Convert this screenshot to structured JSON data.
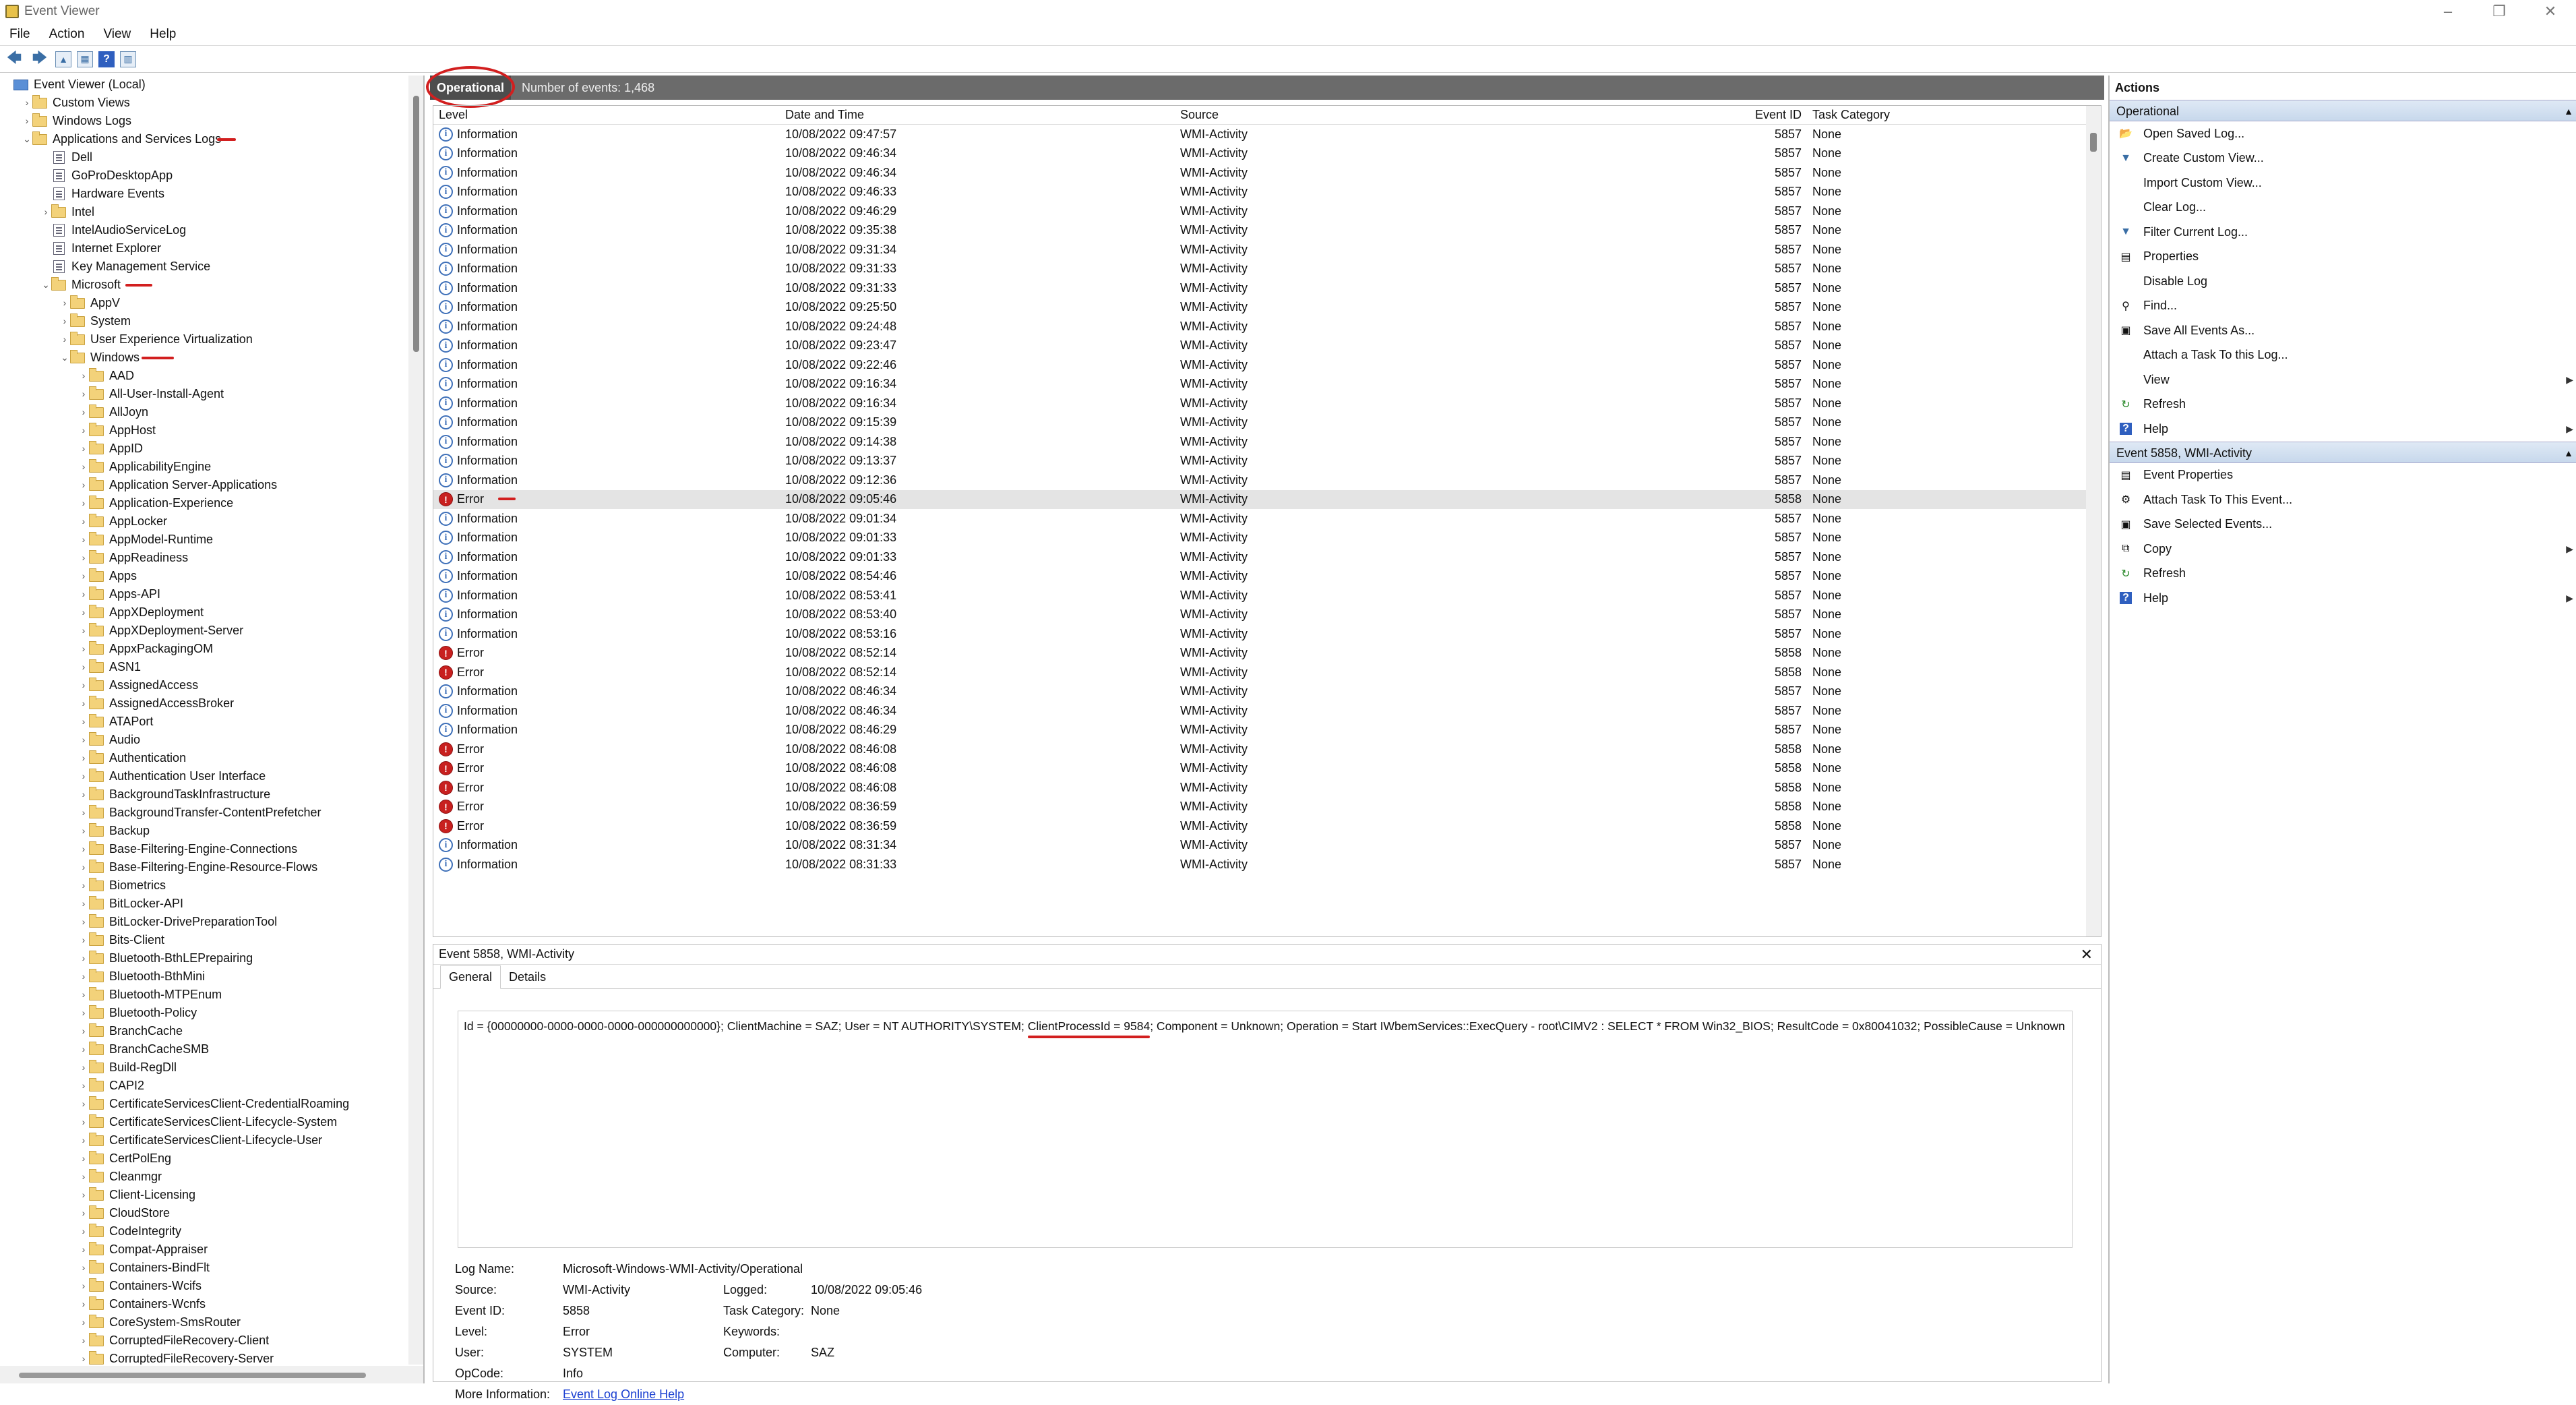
{
  "window": {
    "title": "Event Viewer"
  },
  "menu": [
    "File",
    "Action",
    "View",
    "Help"
  ],
  "tree": [
    {
      "label": "Event Viewer (Local)",
      "indent": 0,
      "arrow": "",
      "icon": "pc"
    },
    {
      "label": "Custom Views",
      "indent": 1,
      "arrow": "›",
      "icon": "folder"
    },
    {
      "label": "Windows Logs",
      "indent": 1,
      "arrow": "›",
      "icon": "folder"
    },
    {
      "label": "Applications and Services Logs",
      "indent": 1,
      "arrow": "⌄",
      "icon": "folder",
      "marked": true
    },
    {
      "label": "Dell",
      "indent": 2,
      "arrow": "",
      "icon": "log"
    },
    {
      "label": "GoProDesktopApp",
      "indent": 2,
      "arrow": "",
      "icon": "log"
    },
    {
      "label": "Hardware Events",
      "indent": 2,
      "arrow": "",
      "icon": "log"
    },
    {
      "label": "Intel",
      "indent": 2,
      "arrow": "›",
      "icon": "folder"
    },
    {
      "label": "IntelAudioServiceLog",
      "indent": 2,
      "arrow": "",
      "icon": "log"
    },
    {
      "label": "Internet Explorer",
      "indent": 2,
      "arrow": "",
      "icon": "log"
    },
    {
      "label": "Key Management Service",
      "indent": 2,
      "arrow": "",
      "icon": "log"
    },
    {
      "label": "Microsoft",
      "indent": 2,
      "arrow": "⌄",
      "icon": "folder",
      "marked": true
    },
    {
      "label": "AppV",
      "indent": 3,
      "arrow": "›",
      "icon": "folder"
    },
    {
      "label": "System",
      "indent": 3,
      "arrow": "›",
      "icon": "folder"
    },
    {
      "label": "User Experience Virtualization",
      "indent": 3,
      "arrow": "›",
      "icon": "folder"
    },
    {
      "label": "Windows",
      "indent": 3,
      "arrow": "⌄",
      "icon": "folder",
      "marked": true
    },
    {
      "label": "AAD",
      "indent": 4,
      "arrow": "›",
      "icon": "folder"
    },
    {
      "label": "All-User-Install-Agent",
      "indent": 4,
      "arrow": "›",
      "icon": "folder"
    },
    {
      "label": "AllJoyn",
      "indent": 4,
      "arrow": "›",
      "icon": "folder"
    },
    {
      "label": "AppHost",
      "indent": 4,
      "arrow": "›",
      "icon": "folder"
    },
    {
      "label": "AppID",
      "indent": 4,
      "arrow": "›",
      "icon": "folder"
    },
    {
      "label": "ApplicabilityEngine",
      "indent": 4,
      "arrow": "›",
      "icon": "folder"
    },
    {
      "label": "Application Server-Applications",
      "indent": 4,
      "arrow": "›",
      "icon": "folder"
    },
    {
      "label": "Application-Experience",
      "indent": 4,
      "arrow": "›",
      "icon": "folder"
    },
    {
      "label": "AppLocker",
      "indent": 4,
      "arrow": "›",
      "icon": "folder"
    },
    {
      "label": "AppModel-Runtime",
      "indent": 4,
      "arrow": "›",
      "icon": "folder"
    },
    {
      "label": "AppReadiness",
      "indent": 4,
      "arrow": "›",
      "icon": "folder"
    },
    {
      "label": "Apps",
      "indent": 4,
      "arrow": "›",
      "icon": "folder"
    },
    {
      "label": "Apps-API",
      "indent": 4,
      "arrow": "›",
      "icon": "folder"
    },
    {
      "label": "AppXDeployment",
      "indent": 4,
      "arrow": "›",
      "icon": "folder"
    },
    {
      "label": "AppXDeployment-Server",
      "indent": 4,
      "arrow": "›",
      "icon": "folder"
    },
    {
      "label": "AppxPackagingOM",
      "indent": 4,
      "arrow": "›",
      "icon": "folder"
    },
    {
      "label": "ASN1",
      "indent": 4,
      "arrow": "›",
      "icon": "folder"
    },
    {
      "label": "AssignedAccess",
      "indent": 4,
      "arrow": "›",
      "icon": "folder"
    },
    {
      "label": "AssignedAccessBroker",
      "indent": 4,
      "arrow": "›",
      "icon": "folder"
    },
    {
      "label": "ATAPort",
      "indent": 4,
      "arrow": "›",
      "icon": "folder"
    },
    {
      "label": "Audio",
      "indent": 4,
      "arrow": "›",
      "icon": "folder"
    },
    {
      "label": "Authentication",
      "indent": 4,
      "arrow": "›",
      "icon": "folder"
    },
    {
      "label": "Authentication User Interface",
      "indent": 4,
      "arrow": "›",
      "icon": "folder"
    },
    {
      "label": "BackgroundTaskInfrastructure",
      "indent": 4,
      "arrow": "›",
      "icon": "folder"
    },
    {
      "label": "BackgroundTransfer-ContentPrefetcher",
      "indent": 4,
      "arrow": "›",
      "icon": "folder"
    },
    {
      "label": "Backup",
      "indent": 4,
      "arrow": "›",
      "icon": "folder"
    },
    {
      "label": "Base-Filtering-Engine-Connections",
      "indent": 4,
      "arrow": "›",
      "icon": "folder"
    },
    {
      "label": "Base-Filtering-Engine-Resource-Flows",
      "indent": 4,
      "arrow": "›",
      "icon": "folder"
    },
    {
      "label": "Biometrics",
      "indent": 4,
      "arrow": "›",
      "icon": "folder"
    },
    {
      "label": "BitLocker-API",
      "indent": 4,
      "arrow": "›",
      "icon": "folder"
    },
    {
      "label": "BitLocker-DrivePreparationTool",
      "indent": 4,
      "arrow": "›",
      "icon": "folder"
    },
    {
      "label": "Bits-Client",
      "indent": 4,
      "arrow": "›",
      "icon": "folder"
    },
    {
      "label": "Bluetooth-BthLEPrepairing",
      "indent": 4,
      "arrow": "›",
      "icon": "folder"
    },
    {
      "label": "Bluetooth-BthMini",
      "indent": 4,
      "arrow": "›",
      "icon": "folder"
    },
    {
      "label": "Bluetooth-MTPEnum",
      "indent": 4,
      "arrow": "›",
      "icon": "folder"
    },
    {
      "label": "Bluetooth-Policy",
      "indent": 4,
      "arrow": "›",
      "icon": "folder"
    },
    {
      "label": "BranchCache",
      "indent": 4,
      "arrow": "›",
      "icon": "folder"
    },
    {
      "label": "BranchCacheSMB",
      "indent": 4,
      "arrow": "›",
      "icon": "folder"
    },
    {
      "label": "Build-RegDll",
      "indent": 4,
      "arrow": "›",
      "icon": "folder"
    },
    {
      "label": "CAPI2",
      "indent": 4,
      "arrow": "›",
      "icon": "folder"
    },
    {
      "label": "CertificateServicesClient-CredentialRoaming",
      "indent": 4,
      "arrow": "›",
      "icon": "folder"
    },
    {
      "label": "CertificateServicesClient-Lifecycle-System",
      "indent": 4,
      "arrow": "›",
      "icon": "folder"
    },
    {
      "label": "CertificateServicesClient-Lifecycle-User",
      "indent": 4,
      "arrow": "›",
      "icon": "folder"
    },
    {
      "label": "CertPolEng",
      "indent": 4,
      "arrow": "›",
      "icon": "folder"
    },
    {
      "label": "Cleanmgr",
      "indent": 4,
      "arrow": "›",
      "icon": "folder"
    },
    {
      "label": "Client-Licensing",
      "indent": 4,
      "arrow": "›",
      "icon": "folder"
    },
    {
      "label": "CloudStore",
      "indent": 4,
      "arrow": "›",
      "icon": "folder"
    },
    {
      "label": "CodeIntegrity",
      "indent": 4,
      "arrow": "›",
      "icon": "folder"
    },
    {
      "label": "Compat-Appraiser",
      "indent": 4,
      "arrow": "›",
      "icon": "folder"
    },
    {
      "label": "Containers-BindFlt",
      "indent": 4,
      "arrow": "›",
      "icon": "folder"
    },
    {
      "label": "Containers-Wcifs",
      "indent": 4,
      "arrow": "›",
      "icon": "folder"
    },
    {
      "label": "Containers-Wcnfs",
      "indent": 4,
      "arrow": "›",
      "icon": "folder"
    },
    {
      "label": "CoreSystem-SmsRouter",
      "indent": 4,
      "arrow": "›",
      "icon": "folder"
    },
    {
      "label": "CorruptedFileRecovery-Client",
      "indent": 4,
      "arrow": "›",
      "icon": "folder"
    },
    {
      "label": "CorruptedFileRecovery-Server",
      "indent": 4,
      "arrow": "›",
      "icon": "folder"
    }
  ],
  "log": {
    "name": "Operational",
    "count": "Number of events: 1,468"
  },
  "columns": [
    "Level",
    "Date and Time",
    "Source",
    "Event ID",
    "Task Category"
  ],
  "events": [
    {
      "level": "Information",
      "date": "10/08/2022 09:47:57",
      "source": "WMI-Activity",
      "id": "5857",
      "task": "None"
    },
    {
      "level": "Information",
      "date": "10/08/2022 09:46:34",
      "source": "WMI-Activity",
      "id": "5857",
      "task": "None"
    },
    {
      "level": "Information",
      "date": "10/08/2022 09:46:34",
      "source": "WMI-Activity",
      "id": "5857",
      "task": "None"
    },
    {
      "level": "Information",
      "date": "10/08/2022 09:46:33",
      "source": "WMI-Activity",
      "id": "5857",
      "task": "None"
    },
    {
      "level": "Information",
      "date": "10/08/2022 09:46:29",
      "source": "WMI-Activity",
      "id": "5857",
      "task": "None"
    },
    {
      "level": "Information",
      "date": "10/08/2022 09:35:38",
      "source": "WMI-Activity",
      "id": "5857",
      "task": "None"
    },
    {
      "level": "Information",
      "date": "10/08/2022 09:31:34",
      "source": "WMI-Activity",
      "id": "5857",
      "task": "None"
    },
    {
      "level": "Information",
      "date": "10/08/2022 09:31:33",
      "source": "WMI-Activity",
      "id": "5857",
      "task": "None"
    },
    {
      "level": "Information",
      "date": "10/08/2022 09:31:33",
      "source": "WMI-Activity",
      "id": "5857",
      "task": "None"
    },
    {
      "level": "Information",
      "date": "10/08/2022 09:25:50",
      "source": "WMI-Activity",
      "id": "5857",
      "task": "None"
    },
    {
      "level": "Information",
      "date": "10/08/2022 09:24:48",
      "source": "WMI-Activity",
      "id": "5857",
      "task": "None"
    },
    {
      "level": "Information",
      "date": "10/08/2022 09:23:47",
      "source": "WMI-Activity",
      "id": "5857",
      "task": "None"
    },
    {
      "level": "Information",
      "date": "10/08/2022 09:22:46",
      "source": "WMI-Activity",
      "id": "5857",
      "task": "None"
    },
    {
      "level": "Information",
      "date": "10/08/2022 09:16:34",
      "source": "WMI-Activity",
      "id": "5857",
      "task": "None"
    },
    {
      "level": "Information",
      "date": "10/08/2022 09:16:34",
      "source": "WMI-Activity",
      "id": "5857",
      "task": "None"
    },
    {
      "level": "Information",
      "date": "10/08/2022 09:15:39",
      "source": "WMI-Activity",
      "id": "5857",
      "task": "None"
    },
    {
      "level": "Information",
      "date": "10/08/2022 09:14:38",
      "source": "WMI-Activity",
      "id": "5857",
      "task": "None"
    },
    {
      "level": "Information",
      "date": "10/08/2022 09:13:37",
      "source": "WMI-Activity",
      "id": "5857",
      "task": "None"
    },
    {
      "level": "Information",
      "date": "10/08/2022 09:12:36",
      "source": "WMI-Activity",
      "id": "5857",
      "task": "None"
    },
    {
      "level": "Error",
      "date": "10/08/2022 09:05:46",
      "source": "WMI-Activity",
      "id": "5858",
      "task": "None",
      "selected": true,
      "marked": true
    },
    {
      "level": "Information",
      "date": "10/08/2022 09:01:34",
      "source": "WMI-Activity",
      "id": "5857",
      "task": "None"
    },
    {
      "level": "Information",
      "date": "10/08/2022 09:01:33",
      "source": "WMI-Activity",
      "id": "5857",
      "task": "None"
    },
    {
      "level": "Information",
      "date": "10/08/2022 09:01:33",
      "source": "WMI-Activity",
      "id": "5857",
      "task": "None"
    },
    {
      "level": "Information",
      "date": "10/08/2022 08:54:46",
      "source": "WMI-Activity",
      "id": "5857",
      "task": "None"
    },
    {
      "level": "Information",
      "date": "10/08/2022 08:53:41",
      "source": "WMI-Activity",
      "id": "5857",
      "task": "None"
    },
    {
      "level": "Information",
      "date": "10/08/2022 08:53:40",
      "source": "WMI-Activity",
      "id": "5857",
      "task": "None"
    },
    {
      "level": "Information",
      "date": "10/08/2022 08:53:16",
      "source": "WMI-Activity",
      "id": "5857",
      "task": "None"
    },
    {
      "level": "Error",
      "date": "10/08/2022 08:52:14",
      "source": "WMI-Activity",
      "id": "5858",
      "task": "None"
    },
    {
      "level": "Error",
      "date": "10/08/2022 08:52:14",
      "source": "WMI-Activity",
      "id": "5858",
      "task": "None"
    },
    {
      "level": "Information",
      "date": "10/08/2022 08:46:34",
      "source": "WMI-Activity",
      "id": "5857",
      "task": "None"
    },
    {
      "level": "Information",
      "date": "10/08/2022 08:46:34",
      "source": "WMI-Activity",
      "id": "5857",
      "task": "None"
    },
    {
      "level": "Information",
      "date": "10/08/2022 08:46:29",
      "source": "WMI-Activity",
      "id": "5857",
      "task": "None"
    },
    {
      "level": "Error",
      "date": "10/08/2022 08:46:08",
      "source": "WMI-Activity",
      "id": "5858",
      "task": "None"
    },
    {
      "level": "Error",
      "date": "10/08/2022 08:46:08",
      "source": "WMI-Activity",
      "id": "5858",
      "task": "None"
    },
    {
      "level": "Error",
      "date": "10/08/2022 08:46:08",
      "source": "WMI-Activity",
      "id": "5858",
      "task": "None"
    },
    {
      "level": "Error",
      "date": "10/08/2022 08:36:59",
      "source": "WMI-Activity",
      "id": "5858",
      "task": "None"
    },
    {
      "level": "Error",
      "date": "10/08/2022 08:36:59",
      "source": "WMI-Activity",
      "id": "5858",
      "task": "None"
    },
    {
      "level": "Information",
      "date": "10/08/2022 08:31:34",
      "source": "WMI-Activity",
      "id": "5857",
      "task": "None"
    },
    {
      "level": "Information",
      "date": "10/08/2022 08:31:33",
      "source": "WMI-Activity",
      "id": "5857",
      "task": "None"
    }
  ],
  "detail": {
    "title": "Event 5858, WMI-Activity",
    "tabs": [
      "General",
      "Details"
    ],
    "message_pre": "Id = {00000000-0000-0000-0000-000000000000}; ClientMachine = SAZ; User = NT AUTHORITY\\SYSTEM; ",
    "message_mark": "ClientProcessId = 9584",
    "message_post": "; Component = Unknown; Operation = Start IWbemServices::ExecQuery - root\\CIMV2 : SELECT * FROM Win32_BIOS; ResultCode = 0x80041032; PossibleCause = Unknown",
    "log_name_label": "Log Name:",
    "log_name": "Microsoft-Windows-WMI-Activity/Operational",
    "source_label": "Source:",
    "source": "WMI-Activity",
    "logged_label": "Logged:",
    "logged": "10/08/2022 09:05:46",
    "event_id_label": "Event ID:",
    "event_id": "5858",
    "task_label": "Task Category:",
    "task": "None",
    "level_label": "Level:",
    "level": "Error",
    "keywords_label": "Keywords:",
    "user_label": "User:",
    "user": "SYSTEM",
    "computer_label": "Computer:",
    "computer": "SAZ",
    "opcode_label": "OpCode:",
    "opcode": "Info",
    "more_label": "More Information:",
    "more_link": "Event Log Online Help"
  },
  "actions": {
    "title": "Actions",
    "section1": "Operational",
    "items1": [
      {
        "label": "Open Saved Log...",
        "icon": "folder-open-icon",
        "glyph": "📂"
      },
      {
        "label": "Create Custom View...",
        "icon": "filter-icon",
        "glyph": "▼"
      },
      {
        "label": "Import Custom View...",
        "icon": "",
        "glyph": ""
      },
      {
        "label": "Clear Log...",
        "icon": "",
        "glyph": ""
      },
      {
        "label": "Filter Current Log...",
        "icon": "filter-icon",
        "glyph": "▼"
      },
      {
        "label": "Properties",
        "icon": "properties-icon",
        "glyph": "▤"
      },
      {
        "label": "Disable Log",
        "icon": "",
        "glyph": ""
      },
      {
        "label": "Find...",
        "icon": "find-icon",
        "glyph": "⚲"
      },
      {
        "label": "Save All Events As...",
        "icon": "save-icon",
        "glyph": "▣"
      },
      {
        "label": "Attach a Task To this Log...",
        "icon": "",
        "glyph": ""
      },
      {
        "label": "View",
        "icon": "",
        "glyph": "",
        "sub": true
      },
      {
        "label": "Refresh",
        "icon": "refresh-icon",
        "glyph": "↻"
      },
      {
        "label": "Help",
        "icon": "help-icon",
        "glyph": "?",
        "sub": true
      }
    ],
    "section2": "Event 5858, WMI-Activity",
    "items2": [
      {
        "label": "Event Properties",
        "icon": "properties-icon",
        "glyph": "▤"
      },
      {
        "label": "Attach Task To This Event...",
        "icon": "task-icon",
        "glyph": "⚙"
      },
      {
        "label": "Save Selected Events...",
        "icon": "save-icon",
        "glyph": "▣"
      },
      {
        "label": "Copy",
        "icon": "copy-icon",
        "glyph": "⧉",
        "sub": true
      },
      {
        "label": "Refresh",
        "icon": "refresh-icon",
        "glyph": "↻"
      },
      {
        "label": "Help",
        "icon": "help-icon",
        "glyph": "?",
        "sub": true
      }
    ]
  }
}
